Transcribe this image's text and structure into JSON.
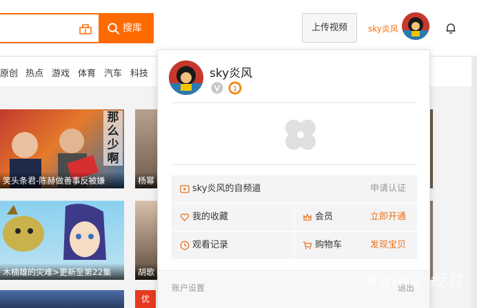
{
  "search": {
    "button_label": "搜库"
  },
  "header": {
    "upload_label": "上传视频",
    "username": "sky炎风"
  },
  "categories": [
    "原创",
    "热点",
    "游戏",
    "体育",
    "汽车",
    "科技"
  ],
  "videos": [
    {
      "caption": "笑头条君-陈赫做善事反被嫌",
      "overlay_text": "那么少啊"
    },
    {
      "caption": "杨幂"
    },
    {
      "caption": "木楠雄的灾难>更新至第22集"
    },
    {
      "caption": "胡歌"
    },
    {
      "caption": "",
      "badge": "优"
    }
  ],
  "dropdown": {
    "name": "sky炎风",
    "level": "1",
    "channel_label": "sky炎风的自频道",
    "channel_action": "申请认证",
    "favorites_label": "我的收藏",
    "member_label": "会员",
    "member_action": "立即开通",
    "history_label": "观看记录",
    "cart_label": "购物车",
    "cart_action": "发现宝贝",
    "settings_label": "账户设置",
    "logout_label": "退出"
  },
  "watermark": "Baidu 经验",
  "colors": {
    "accent": "#ff6a00",
    "action_orange": "#e8711a",
    "muted": "#999999",
    "badge_red": "#e53a1f"
  },
  "icons": [
    "camera-icon",
    "search-icon",
    "bell-icon",
    "v-icon",
    "level-icon",
    "clover-placeholder-icon",
    "channel-icon",
    "heart-icon",
    "crown-icon",
    "clock-icon",
    "cart-icon"
  ]
}
